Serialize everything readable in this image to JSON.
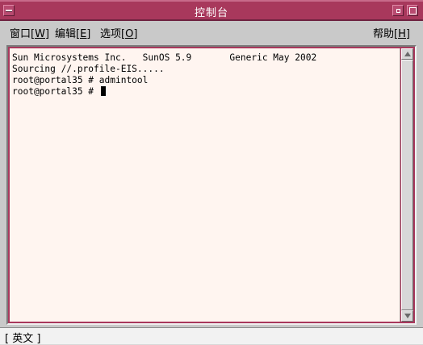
{
  "window": {
    "title": "控制台"
  },
  "menubar": {
    "window": {
      "label": "窗口",
      "mnemonic": "[W]"
    },
    "edit": {
      "label": "编辑",
      "mnemonic": "[E]"
    },
    "options": {
      "label": "选项",
      "mnemonic": "[O]"
    },
    "help": {
      "label": "帮助",
      "mnemonic": "[H]"
    }
  },
  "terminal": {
    "lines": [
      "Sun Microsystems Inc.   SunOS 5.9       Generic May 2002",
      "Sourcing //.profile-EIS.....",
      "root@portal35 # admintool",
      "root@portal35 # "
    ]
  },
  "statusbar": {
    "ime": "[ 英文 ]"
  },
  "colors": {
    "titlebar": "#a8385c",
    "terminal_bg": "#fff5f0",
    "chrome": "#c9c9c9"
  }
}
